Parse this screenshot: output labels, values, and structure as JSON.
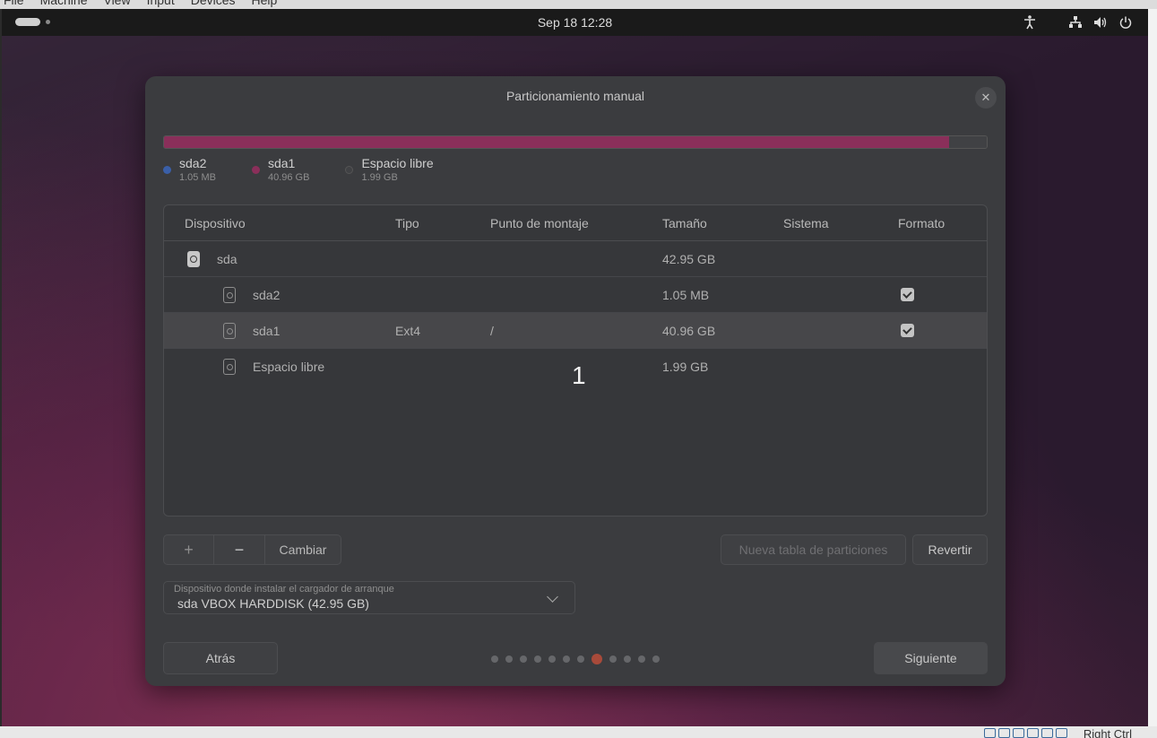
{
  "host": {
    "menu": [
      "File",
      "Machine",
      "View",
      "Input",
      "Devices",
      "Help"
    ],
    "status_hint": "Right Ctrl"
  },
  "topbar": {
    "clock": "Sep 18  12:28",
    "icons": [
      "accessibility-icon",
      "network-icon",
      "volume-icon",
      "power-icon"
    ]
  },
  "dialog": {
    "title": "Particionamiento manual",
    "usage": [
      {
        "name": "sda2",
        "size": "1.05 MB",
        "color": "#3a5fa8",
        "fraction": 0.0
      },
      {
        "name": "sda1",
        "size": "40.96 GB",
        "color": "#8a2f5a",
        "fraction": 0.954
      },
      {
        "name": "Espacio libre",
        "size": "1.99 GB",
        "color": "#404144",
        "fraction": 0.046
      }
    ],
    "table": {
      "headers": [
        "Dispositivo",
        "Tipo",
        "Punto de montaje",
        "Tamaño",
        "Sistema",
        "Formato"
      ],
      "rows": [
        {
          "device": "sda",
          "type": "",
          "mount": "",
          "size": "42.95 GB",
          "system": "",
          "format": null,
          "level": 0
        },
        {
          "device": "sda2",
          "type": "",
          "mount": "",
          "size": "1.05 MB",
          "system": "",
          "format": true,
          "level": 1
        },
        {
          "device": "sda1",
          "type": "Ext4",
          "mount": "/",
          "size": "40.96 GB",
          "system": "",
          "format": true,
          "level": 1,
          "selected": true
        },
        {
          "device": "Espacio libre",
          "type": "",
          "mount": "",
          "size": "1.99 GB",
          "system": "",
          "format": null,
          "level": 1
        }
      ]
    },
    "overlay_number": "1",
    "toolbar": {
      "add_label": "+",
      "remove_label": "−",
      "change_label": "Cambiar",
      "new_table_label": "Nueva tabla de particiones",
      "revert_label": "Revertir"
    },
    "bootloader": {
      "label": "Dispositivo donde instalar el cargador de arranque",
      "value": "sda VBOX HARDDISK (42.95 GB)"
    },
    "nav": {
      "back_label": "Atrás",
      "next_label": "Siguiente",
      "page_count": 12,
      "current_page": 8
    }
  }
}
